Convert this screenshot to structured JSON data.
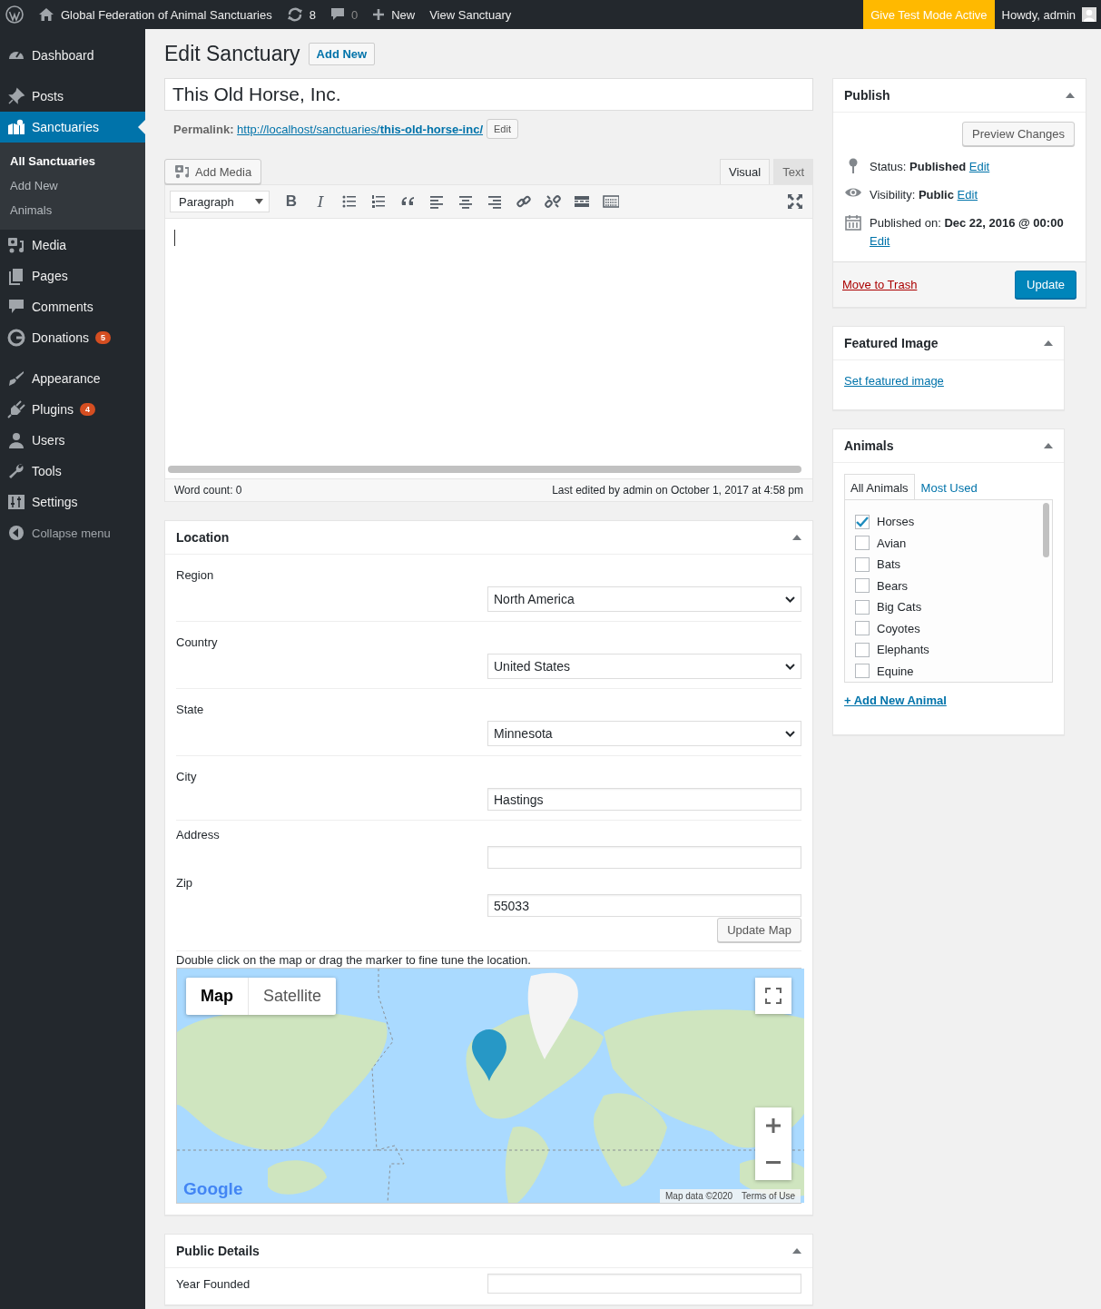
{
  "admin_bar": {
    "site_title": "Global Federation of Animal Sanctuaries",
    "updates": "8",
    "comments": "0",
    "new": "New",
    "view": "View Sanctuary",
    "test_mode": "Give Test Mode Active",
    "howdy": "Howdy, admin"
  },
  "menu_groups": [
    [
      {
        "label": "Dashboard",
        "selected": false
      }
    ],
    [
      {
        "label": "Posts",
        "selected": false
      },
      {
        "label": "Sanctuaries",
        "selected": true,
        "children": [
          {
            "label": "All Sanctuaries",
            "selected": true
          },
          {
            "label": "Add New",
            "selected": false
          },
          {
            "label": "Animals",
            "selected": false
          }
        ]
      },
      {
        "label": "Media",
        "selected": false
      },
      {
        "label": "Pages",
        "selected": false
      },
      {
        "label": "Comments",
        "selected": false
      },
      {
        "label": "Donations",
        "selected": false,
        "badge": "5"
      }
    ],
    [
      {
        "label": "Appearance",
        "selected": false
      },
      {
        "label": "Plugins",
        "selected": false,
        "badge": "4"
      },
      {
        "label": "Users",
        "selected": false
      },
      {
        "label": "Tools",
        "selected": false
      },
      {
        "label": "Settings",
        "selected": false
      }
    ]
  ],
  "collapse_menu": "Collapse menu",
  "page": {
    "title": "Edit Sanctuary",
    "add_new": "Add New"
  },
  "post_title": {
    "value": "This Old Horse, Inc."
  },
  "permalink": {
    "label": "Permalink:",
    "url": "http://localhost/sanctuaries/**this-old-horse-inc/**",
    "edit": "Edit"
  },
  "editor": {
    "add_media": "Add Media",
    "tabs": [
      {
        "label": "Visual",
        "selected": true
      },
      {
        "label": "Text",
        "selected": false
      }
    ],
    "format": "Paragraph",
    "bold": "B",
    "italic": "I",
    "word_count": "Word count: 0",
    "last_edited": "Last edited by admin on October 1, 2017 at 4:58 pm"
  },
  "location": {
    "title": "Location",
    "fields": [
      {
        "label": "Region",
        "kind": "select",
        "value": "North America"
      },
      {
        "label": "Country",
        "kind": "select",
        "value": "United States"
      },
      {
        "label": "State",
        "kind": "select",
        "value": "Minnesota"
      },
      {
        "label": "City",
        "kind": "text",
        "value": "Hastings"
      }
    ],
    "address_fields": [
      {
        "label": "Address",
        "kind": "text"
      },
      {
        "label": "Zip",
        "kind": "text",
        "value": "55033"
      }
    ],
    "update_map": "Update Map",
    "hint": "Double click on the map or drag the marker to fine tune the location.",
    "map": {
      "type_buttons": [
        {
          "label": "Map",
          "selected": true
        },
        {
          "label": "Satellite",
          "selected": false
        }
      ],
      "logo": "Google",
      "attribution": "Map data ©2020",
      "terms": "Terms of Use"
    }
  },
  "public_details": {
    "title": "Public Details",
    "fields": [
      {
        "label": "Year Founded",
        "kind": "text"
      }
    ]
  },
  "publish": {
    "title": "Publish",
    "preview": "Preview Changes",
    "rows": [
      {
        "text": "Status: **Published**",
        "edit": "Edit"
      },
      {
        "text": "Visibility: **Public**",
        "edit": "Edit"
      },
      {
        "text": "Published on: **Dec 22, 2016 @ 00:00**",
        "edit": "Edit"
      }
    ],
    "trash": "Move to Trash",
    "update": "Update"
  },
  "featured_image": {
    "title": "Featured Image",
    "link": "Set featured image"
  },
  "animals": {
    "title": "Animals",
    "tabs": [
      {
        "label": "All Animals",
        "selected": true
      },
      {
        "label": "Most Used",
        "selected": false
      }
    ],
    "items": [
      {
        "label": "Horses",
        "checked": true
      },
      {
        "label": "Avian",
        "checked": false
      },
      {
        "label": "Bats",
        "checked": false
      },
      {
        "label": "Bears",
        "checked": false
      },
      {
        "label": "Big Cats",
        "checked": false
      },
      {
        "label": "Coyotes",
        "checked": false
      },
      {
        "label": "Elephants",
        "checked": false
      },
      {
        "label": "Equine",
        "checked": false
      }
    ],
    "add_new": "+ Add New Animal"
  }
}
